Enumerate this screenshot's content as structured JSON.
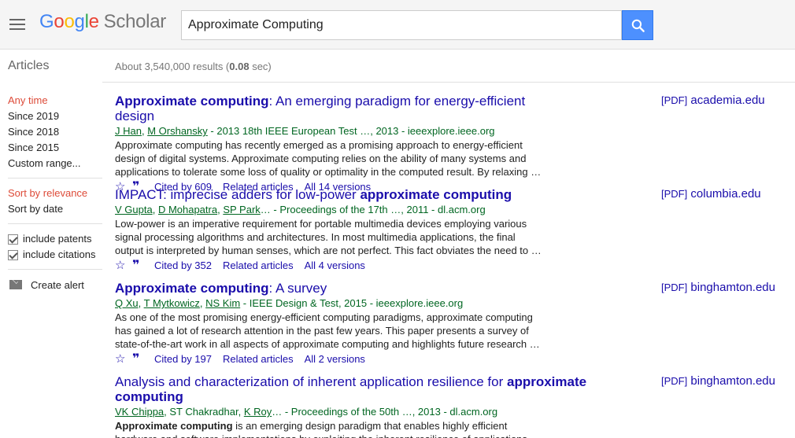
{
  "header": {
    "logo_google": [
      "G",
      "o",
      "o",
      "g",
      "l",
      "e"
    ],
    "logo_scholar": "Scholar",
    "search_value": "Approximate Computing"
  },
  "subheader": {
    "articles_label": "Articles",
    "count_prefix": "About 3,540,000 results (",
    "count_time": "0.08",
    "count_suffix": " sec)"
  },
  "sidebar": {
    "time_filters": [
      "Any time",
      "Since 2019",
      "Since 2018",
      "Since 2015",
      "Custom range..."
    ],
    "sort_options": [
      "Sort by relevance",
      "Sort by date"
    ],
    "include_patents": "include patents",
    "include_citations": "include citations",
    "create_alert": "Create alert"
  },
  "results": [
    {
      "title_bold": "Approximate computing",
      "title_rest": ": An emerging paradigm for energy-efficient design",
      "authors": [
        "J Han",
        "M Orshansky"
      ],
      "source": " - 2013 18th IEEE European Test …, 2013 - ieeexplore.ieee.org",
      "snippet": "Approximate computing has recently emerged as a promising approach to energy-efficient design of digital systems. Approximate computing relies on the ability of many systems and applications to tolerate some loss of quality or optimality in the computed result. By relaxing …",
      "cited_by": "Cited by 609",
      "related": "Related articles",
      "versions": "All 14 versions",
      "pdf_tag": "[PDF]",
      "pdf_domain": "academia.edu"
    },
    {
      "title_pre": "IMPACT: imprecise adders for low-power ",
      "title_bold": "approximate computing",
      "authors": [
        "V Gupta",
        "D Mohapatra",
        "SP Park"
      ],
      "source": "… - Proceedings of the 17th …, 2011 - dl.acm.org",
      "snippet": "Low-power is an imperative requirement for portable multimedia devices employing various signal processing algorithms and architectures. In most multimedia applications, the final output is interpreted by human senses, which are not perfect. This fact obviates the need to …",
      "cited_by": "Cited by 352",
      "related": "Related articles",
      "versions": "All 4 versions",
      "pdf_tag": "[PDF]",
      "pdf_domain": "columbia.edu"
    },
    {
      "title_bold": "Approximate computing",
      "title_rest": ": A survey",
      "authors": [
        "Q Xu",
        "T Mytkowicz",
        "NS Kim"
      ],
      "source": " - IEEE Design & Test, 2015 - ieeexplore.ieee.org",
      "snippet": "As one of the most promising energy-efficient computing paradigms, approximate computing has gained a lot of research attention in the past few years. This paper presents a survey of state-of-the-art work in all aspects of approximate computing and highlights future research …",
      "cited_by": "Cited by 197",
      "related": "Related articles",
      "versions": "All 2 versions",
      "pdf_tag": "[PDF]",
      "pdf_domain": "binghamton.edu"
    },
    {
      "title_pre": "Analysis and characterization of inherent application resilience for ",
      "title_bold": "approximate computing",
      "authors": [
        "VK Chippa"
      ],
      "source_mid": ", ST Chakradhar, ",
      "authors2": [
        "K Roy"
      ],
      "source": "… - Proceedings of the 50th …, 2013 - dl.acm.org",
      "snippet_bold": "Approximate computing",
      "snippet": " is an emerging design paradigm that enables highly efficient hardware and software implementations by exploiting the inherent resilience of applications",
      "pdf_tag": "[PDF]",
      "pdf_domain": "binghamton.edu"
    }
  ],
  "colors": {
    "link": "#1a0dab",
    "green": "#006621",
    "active": "#dd4b39",
    "search_button": "#4d90fe"
  },
  "icons": [
    "menu-icon",
    "search-icon",
    "star-icon",
    "quote-icon",
    "mail-icon",
    "checkbox-icon"
  ]
}
